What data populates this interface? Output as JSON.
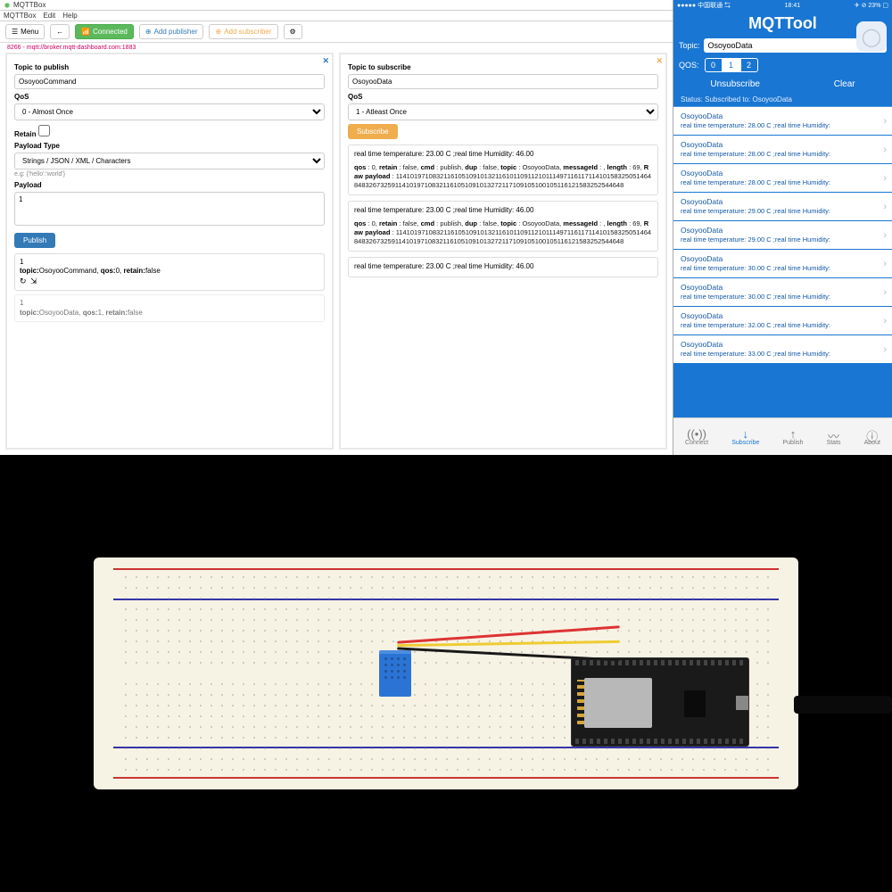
{
  "mqttbox": {
    "window_title": "MQTTBox",
    "menubar": [
      "MQTTBox",
      "Edit",
      "Help"
    ],
    "toolbar": {
      "menu_label": "Menu",
      "back_icon": "←",
      "connected_label": "Connected",
      "add_publisher_label": "Add publisher",
      "add_subscriber_label": "Add subscriber",
      "settings_icon": "⚙"
    },
    "breadcrumb": "8266 - mqtt://broker.mqtt-dashboard.com:1883",
    "publish": {
      "close": "✕",
      "title": "Topic to publish",
      "topic_value": "OsoyooCommand",
      "qos_label": "QoS",
      "qos_value": "0 - Almost Once",
      "retain_label": "Retain",
      "payload_type_label": "Payload Type",
      "payload_type_value": "Strings / JSON / XML / Characters",
      "payload_hint": "e.g: {'hello':'world'}",
      "payload_label": "Payload",
      "payload_value": "1",
      "publish_btn": "Publish",
      "sent1_line1": "1",
      "sent1_line2": "topic:OsoyooCommand, qos:0, retain:false",
      "sent2_line1": "1",
      "sent2_line2": "topic:OsoyooData, qos:1, retain:false"
    },
    "subscribe": {
      "close": "✕",
      "title": "Topic to subscribe",
      "topic_value": "OsoyooData",
      "qos_label": "QoS",
      "qos_value": "1 - Atleast Once",
      "subscribe_btn": "Subscribe",
      "msg1_title": "real time temperature: 23.00 C ;real time Humidity: 46.00",
      "msg1_meta_html": "qos : 0, retain : false, cmd : publish, dup : false, topic : OsoyooData, messageId : , length : 69, Raw payload : 11410197108321161051091013211610110911210111497116117114101583250514648483267325911410197108321161051091013272117109105100105116121583252544648",
      "msg2_title": "real time temperature: 23.00 C ;real time Humidity: 46.00",
      "msg2_meta_html": "qos : 0, retain : false, cmd : publish, dup : false, topic : OsoyooData, messageId : , length : 69, Raw payload : 11410197108321161051091013211610110911210111497116117114101583250514648483267325911410197108321161051091013272117109105100105116121583252544648",
      "msg3_title": "real time temperature: 23.00 C ;real time Humidity: 46.00"
    }
  },
  "mqtttool": {
    "status_left": "●●●●● 中国联通 ⇆",
    "status_time": "18:41",
    "status_right": "✈ ⊘ 23% ▢",
    "app_title": "MQTTool",
    "topic_label": "Topic:",
    "topic_value": "OsoyooData",
    "qos_label": "QOS:",
    "qos_options": [
      "0",
      "1",
      "2"
    ],
    "qos_selected": 1,
    "corner_icon": "◯",
    "unsubscribe": "Unsubscribe",
    "clear": "Clear",
    "status_line": "Status: Subscribed to: OsoyooData",
    "messages": [
      {
        "topic": "OsoyooData",
        "text": "real time temperature: 28.00 C ;real time Humidity:"
      },
      {
        "topic": "OsoyooData",
        "text": "real time temperature: 28.00 C ;real time Humidity:"
      },
      {
        "topic": "OsoyooData",
        "text": "real time temperature: 28.00 C ;real time Humidity:"
      },
      {
        "topic": "OsoyooData",
        "text": "real time temperature: 29.00 C ;real time Humidity:"
      },
      {
        "topic": "OsoyooData",
        "text": "real time temperature: 29.00 C ;real time Humidity:"
      },
      {
        "topic": "OsoyooData",
        "text": "real time temperature: 30.00 C ;real time Humidity:"
      },
      {
        "topic": "OsoyooData",
        "text": "real time temperature: 30.00 C ;real time Humidity:"
      },
      {
        "topic": "OsoyooData",
        "text": "real time temperature: 32.00 C ;real time Humidity:"
      },
      {
        "topic": "OsoyooData",
        "text": "real time temperature: 33.00 C ;real time Humidity:"
      }
    ],
    "tabs": [
      {
        "icon": "((•))",
        "label": "Connect"
      },
      {
        "icon": "↓",
        "label": "Subscribe"
      },
      {
        "icon": "↑",
        "label": "Publish"
      },
      {
        "icon": "〰",
        "label": "Stats"
      },
      {
        "icon": "ⓘ",
        "label": "About"
      }
    ],
    "active_tab": 1
  }
}
